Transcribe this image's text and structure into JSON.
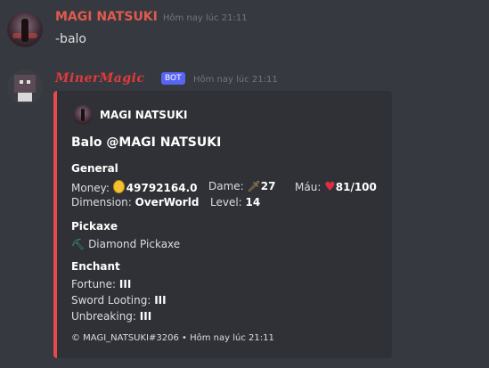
{
  "message1": {
    "author": "MAGI NATSUKI",
    "timestamp": "Hôm nay lúc 21:11",
    "content": "-balo"
  },
  "message2": {
    "author": "MinerMagic",
    "bot_tag": "BOT",
    "timestamp": "Hôm nay lúc 21:11",
    "embed": {
      "accent_color": "#e84a4a",
      "author": "MAGI NATSUKI",
      "title": "Balo @MAGI NATSUKI",
      "general": {
        "heading": "General",
        "money_label": "Money:",
        "money_value": "49792164.0",
        "dame_label": "Dame:",
        "dame_value": "27",
        "mau_label": "Máu:",
        "mau_value": "81/100",
        "dimension_label": "Dimension:",
        "dimension_value": "OverWorld",
        "level_label": "Level:",
        "level_value": "14"
      },
      "pickaxe": {
        "heading": "Pickaxe",
        "value": "Diamond Pickaxe"
      },
      "enchant": {
        "heading": "Enchant",
        "items": [
          {
            "label": "Fortune:",
            "value": "III"
          },
          {
            "label": "Sword Looting:",
            "value": "III"
          },
          {
            "label": "Unbreaking:",
            "value": "III"
          }
        ]
      },
      "footer": "© MAGI_NATSUKI#3206 • Hôm nay lúc 21:11"
    }
  },
  "icons": [
    "coin-icon",
    "sword-icon",
    "heart-icon",
    "pickaxe-icon"
  ]
}
